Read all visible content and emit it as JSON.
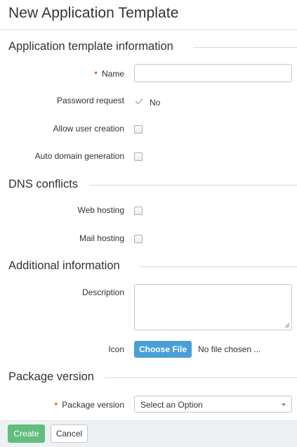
{
  "page": {
    "title": "New Application Template"
  },
  "sections": {
    "template_info": "Application template information",
    "dns_conflicts": "DNS conflicts",
    "additional_info": "Additional information",
    "package_version": "Package version"
  },
  "fields": {
    "name": {
      "label": "Name",
      "required": true,
      "value": ""
    },
    "password_request": {
      "label": "Password request",
      "value": "No",
      "icon": "check-icon"
    },
    "allow_user_creation": {
      "label": "Allow user creation",
      "checked": false
    },
    "auto_domain_generation": {
      "label": "Auto domain generation",
      "checked": false
    },
    "web_hosting": {
      "label": "Web hosting",
      "checked": false
    },
    "mail_hosting": {
      "label": "Mail hosting",
      "checked": false
    },
    "description": {
      "label": "Description",
      "value": ""
    },
    "icon": {
      "label": "Icon",
      "button_label": "Choose File",
      "status": "No file chosen ..."
    },
    "package_version": {
      "label": "Package version",
      "required": true,
      "selected": "Select an Option"
    }
  },
  "footer": {
    "create_label": "Create",
    "cancel_label": "Cancel"
  },
  "colors": {
    "required_marker": "#e8702a",
    "file_button": "#4a9fd8",
    "create_button": "#62bd7e",
    "footer_bg": "#eef1f4"
  }
}
